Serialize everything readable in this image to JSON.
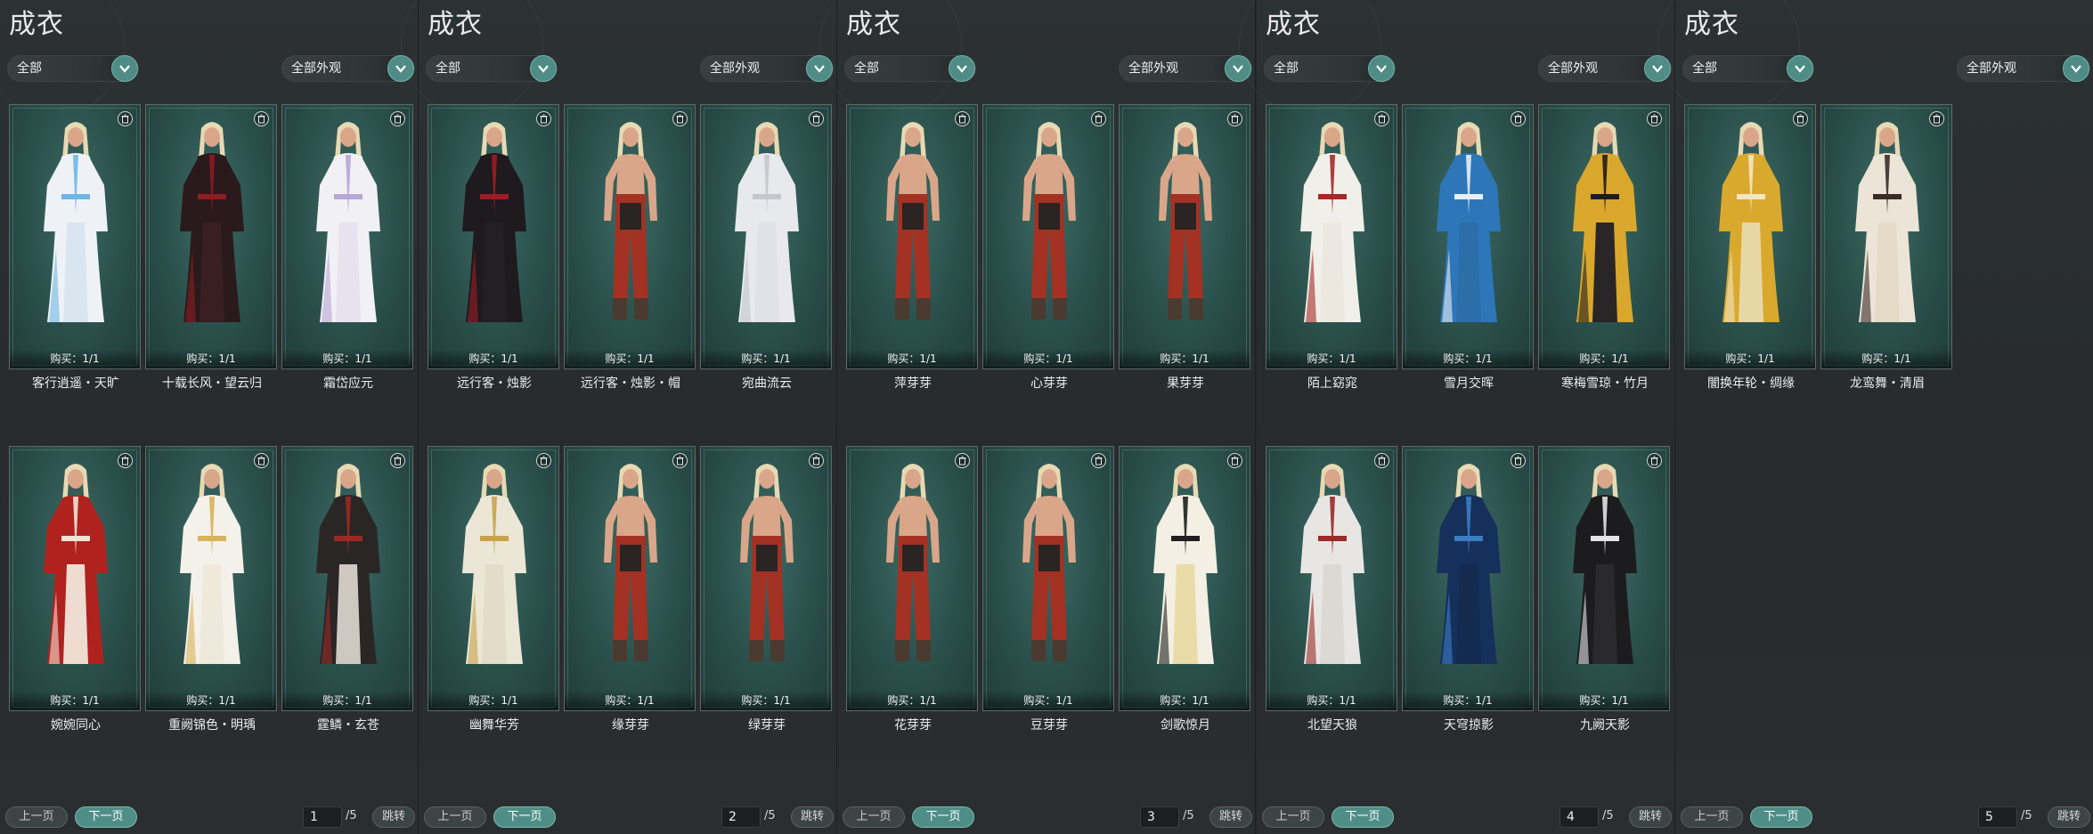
{
  "colors": {
    "accent": "#4f8e86",
    "card_bg": "#2a4f4b",
    "panel_bg": "#2a2e30"
  },
  "icons": {
    "dropdown": "chevron-down-icon",
    "delete": "trash-icon"
  },
  "panels": [
    {
      "title": "成衣",
      "filter_category": "全部",
      "filter_look": "全部外观",
      "items": [
        {
          "name": "客行逍遥・天旷",
          "buy": "购买：1/1",
          "outfit": {
            "robe": "#eef2f6",
            "trim": "#6fb7e6",
            "pants": "#d9e6f0",
            "bare": false
          }
        },
        {
          "name": "十载长风・望云归",
          "buy": "购买：1/1",
          "outfit": {
            "robe": "#2a1a1c",
            "trim": "#8e1c22",
            "pants": "#3a1f22",
            "bare": false
          }
        },
        {
          "name": "霜岱应元",
          "buy": "购买：1/1",
          "outfit": {
            "robe": "#f1f0f4",
            "trim": "#b7a6d6",
            "pants": "#e6e2ee",
            "bare": false
          }
        },
        {
          "name": "婉婉同心",
          "buy": "购买：1/1",
          "outfit": {
            "robe": "#b0221e",
            "trim": "#f1e3d6",
            "pants": "#eedcd0",
            "bare": false
          }
        },
        {
          "name": "重阙锦色・明瑀",
          "buy": "购买：1/1",
          "outfit": {
            "robe": "#f4f1ea",
            "trim": "#d8b35a",
            "pants": "#efe9dc",
            "bare": false
          }
        },
        {
          "name": "霆鳞・玄苍",
          "buy": "购买：1/1",
          "outfit": {
            "robe": "#2a2626",
            "trim": "#9b2a24",
            "pants": "#cfc8c0",
            "bare": false
          }
        }
      ],
      "prev_label": "上一页",
      "next_label": "下一页",
      "page": "1",
      "total": "/5",
      "jump_label": "跳转"
    },
    {
      "title": "成衣",
      "filter_category": "全部",
      "filter_look": "全部外观",
      "items": [
        {
          "name": "远行客・烛影",
          "buy": "购买：1/1",
          "outfit": {
            "robe": "#1e1a1e",
            "trim": "#9c1d24",
            "pants": "#241f22",
            "bare": false
          }
        },
        {
          "name": "远行客・烛影・帽",
          "buy": "购买：1/1",
          "outfit": {
            "robe": "#a33224",
            "trim": "#2a2422",
            "pants": "#a33224",
            "bare": true
          }
        },
        {
          "name": "宛曲流云",
          "buy": "购买：1/1",
          "outfit": {
            "robe": "#e7e9ec",
            "trim": "#c3c8ce",
            "pants": "#dfe2e6",
            "bare": false
          }
        },
        {
          "name": "幽舞华芳",
          "buy": "购买：1/1",
          "outfit": {
            "robe": "#ebe6d6",
            "trim": "#c8a24a",
            "pants": "#e2dcc8",
            "bare": false
          }
        },
        {
          "name": "缘芽芽",
          "buy": "购买：1/1",
          "outfit": {
            "robe": "#a33224",
            "trim": "#2a2422",
            "pants": "#a33224",
            "bare": true
          }
        },
        {
          "name": "绿芽芽",
          "buy": "购买：1/1",
          "outfit": {
            "robe": "#a33224",
            "trim": "#2a2422",
            "pants": "#a33224",
            "bare": true
          }
        }
      ],
      "prev_label": "上一页",
      "next_label": "下一页",
      "page": "2",
      "total": "/5",
      "jump_label": "跳转"
    },
    {
      "title": "成衣",
      "filter_category": "全部",
      "filter_look": "全部外观",
      "items": [
        {
          "name": "萍芽芽",
          "buy": "购买：1/1",
          "outfit": {
            "robe": "#a33224",
            "trim": "#2a2422",
            "pants": "#a33224",
            "bare": true
          }
        },
        {
          "name": "心芽芽",
          "buy": "购买：1/1",
          "outfit": {
            "robe": "#a33224",
            "trim": "#2a2422",
            "pants": "#a33224",
            "bare": true
          }
        },
        {
          "name": "果芽芽",
          "buy": "购买：1/1",
          "outfit": {
            "robe": "#a33224",
            "trim": "#2a2422",
            "pants": "#a33224",
            "bare": true
          }
        },
        {
          "name": "花芽芽",
          "buy": "购买：1/1",
          "outfit": {
            "robe": "#a33224",
            "trim": "#2a2422",
            "pants": "#a33224",
            "bare": true
          }
        },
        {
          "name": "豆芽芽",
          "buy": "购买：1/1",
          "outfit": {
            "robe": "#a33224",
            "trim": "#2a2422",
            "pants": "#a33224",
            "bare": true
          }
        },
        {
          "name": "剑歌惊月",
          "buy": "购买：1/1",
          "outfit": {
            "robe": "#f3efe2",
            "trim": "#1e1e1e",
            "pants": "#e9dca8",
            "bare": false
          }
        }
      ],
      "prev_label": "上一页",
      "next_label": "下一页",
      "page": "3",
      "total": "/5",
      "jump_label": "跳转"
    },
    {
      "title": "成衣",
      "filter_category": "全部",
      "filter_look": "全部外观",
      "items": [
        {
          "name": "陌上窈窕",
          "buy": "购买：1/1",
          "outfit": {
            "robe": "#f1efe9",
            "trim": "#a52a25",
            "pants": "#ece8e0",
            "bare": false
          }
        },
        {
          "name": "雪月交晖",
          "buy": "购买：1/1",
          "outfit": {
            "robe": "#2d77b9",
            "trim": "#e9eef4",
            "pants": "#2b6ea8",
            "bare": false
          }
        },
        {
          "name": "寒梅雪琼・竹月",
          "buy": "购买：1/1",
          "outfit": {
            "robe": "#d9a72c",
            "trim": "#1e1c1e",
            "pants": "#2a2628",
            "bare": false
          }
        },
        {
          "name": "北望天狼",
          "buy": "购买：1/1",
          "outfit": {
            "robe": "#e8e6e4",
            "trim": "#9a2a26",
            "pants": "#dcd8d4",
            "bare": false
          }
        },
        {
          "name": "天穹掠影",
          "buy": "购买：1/1",
          "outfit": {
            "robe": "#16305c",
            "trim": "#3d7dc4",
            "pants": "#142a4e",
            "bare": false
          }
        },
        {
          "name": "九阙天影",
          "buy": "购买：1/1",
          "outfit": {
            "robe": "#1c1c1e",
            "trim": "#e4e4e6",
            "pants": "#2a2a2c",
            "bare": false
          }
        }
      ],
      "prev_label": "上一页",
      "next_label": "下一页",
      "page": "4",
      "total": "/5",
      "jump_label": "跳转"
    },
    {
      "title": "成衣",
      "filter_category": "全部",
      "filter_look": "全部外观",
      "items": [
        {
          "name": "闇换年轮・绸缘",
          "buy": "购买：1/1",
          "outfit": {
            "robe": "#d9a92e",
            "trim": "#f1e6c4",
            "pants": "#e8d7a6",
            "bare": false
          }
        },
        {
          "name": "龙鸾舞・清眉",
          "buy": "购买：1/1",
          "outfit": {
            "robe": "#ece4d6",
            "trim": "#3a2c28",
            "pants": "#e4dac8",
            "bare": false
          }
        }
      ],
      "prev_label": "上一页",
      "next_label": "下一页",
      "page": "5",
      "total": "/5",
      "jump_label": "跳转"
    }
  ]
}
